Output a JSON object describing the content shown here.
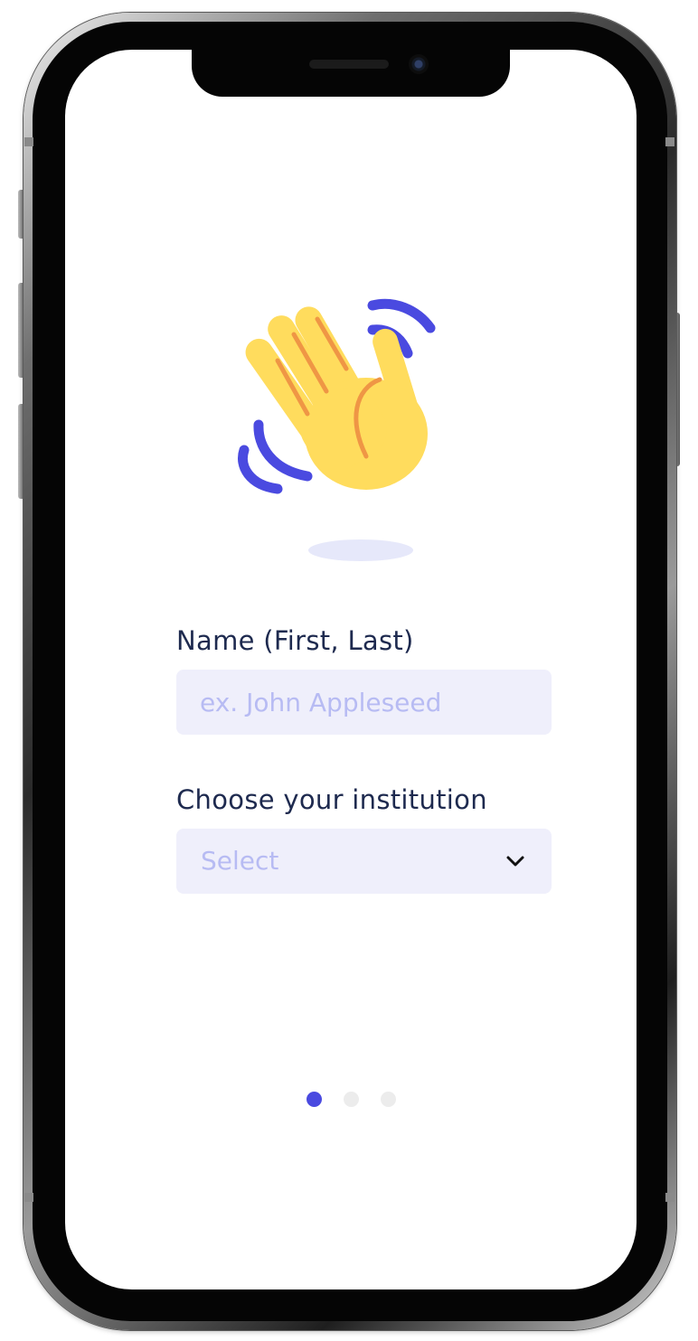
{
  "form": {
    "name_label": "Name (First, Last)",
    "name_placeholder": "ex. John Appleseed",
    "institution_label": "Choose your institution",
    "institution_value": "Select"
  },
  "icons": {
    "hero": "waving-hand-icon",
    "dropdown": "chevron-down-icon"
  },
  "pagination": {
    "total": 3,
    "current": 1
  },
  "colors": {
    "accent": "#4a4ae0",
    "hand": "#ffdc5d",
    "hand_lines": "#ef9645",
    "label_text": "#1e2a4f",
    "field_background": "#efeffb",
    "placeholder": "#b7bbf3",
    "dot_inactive": "#ececec"
  }
}
